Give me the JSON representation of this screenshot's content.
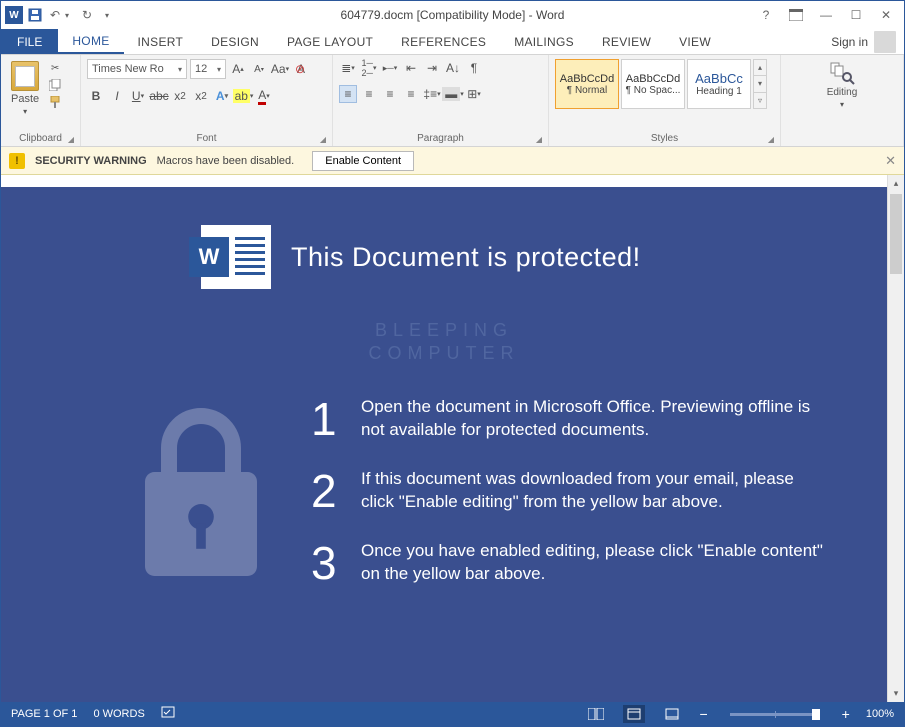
{
  "titlebar": {
    "title": "604779.docm [Compatibility Mode] - Word",
    "help_icon": "?",
    "ribbon_display_icon": "▭"
  },
  "tabs": {
    "file": "FILE",
    "items": [
      "HOME",
      "INSERT",
      "DESIGN",
      "PAGE LAYOUT",
      "REFERENCES",
      "MAILINGS",
      "REVIEW",
      "VIEW"
    ],
    "active_index": 0,
    "signin": "Sign in"
  },
  "ribbon": {
    "clipboard": {
      "paste": "Paste",
      "label": "Clipboard"
    },
    "font": {
      "name": "Times New Ro",
      "size": "12",
      "label": "Font"
    },
    "paragraph": {
      "label": "Paragraph"
    },
    "styles": {
      "label": "Styles",
      "items": [
        {
          "preview": "AaBbCcDd",
          "name": "¶ Normal"
        },
        {
          "preview": "AaBbCcDd",
          "name": "¶ No Spac..."
        },
        {
          "preview": "AaBbCc",
          "name": "Heading 1"
        }
      ],
      "active_index": 0
    },
    "editing": {
      "label": "Editing"
    }
  },
  "security_bar": {
    "title": "SECURITY WARNING",
    "message": "Macros have been disabled.",
    "button": "Enable Content"
  },
  "document": {
    "heading": "This Document is protected!",
    "watermark_line1": "BLEEPING",
    "watermark_line2": "COMPUTER",
    "steps": [
      {
        "n": "1",
        "text": "Open the document in Microsoft Office. Previewing offline is not available for protected documents."
      },
      {
        "n": "2",
        "text": "If this document was downloaded from your email, please click \"Enable editing\" from the yellow bar above."
      },
      {
        "n": "3",
        "text": "Once you have enabled editing, please click \"Enable content\" on the yellow bar above."
      }
    ]
  },
  "status": {
    "page": "PAGE 1 OF 1",
    "words": "0 WORDS",
    "zoom_minus": "−",
    "zoom_plus": "+",
    "zoom_value": "100%"
  }
}
